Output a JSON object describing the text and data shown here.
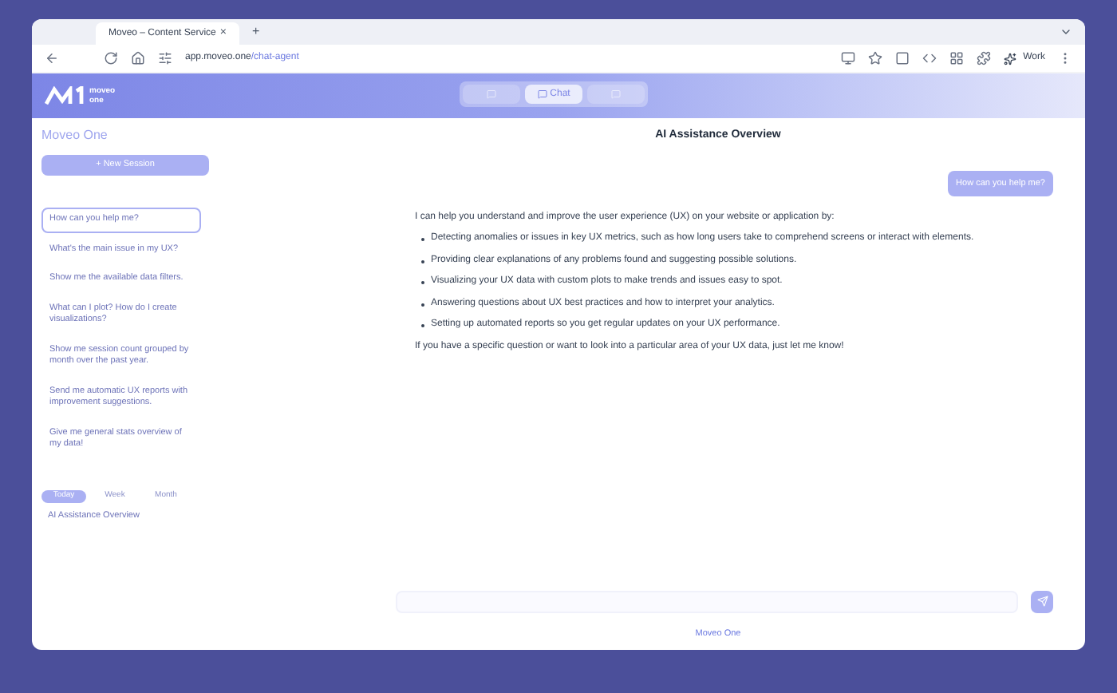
{
  "browser": {
    "tab_title": "Moveo – Content Service",
    "tab_close": "×",
    "new_tab": "+",
    "url_host": "app.moveo.one",
    "url_path": "/chat-agent",
    "profile": "Work"
  },
  "header": {
    "logo_text": "moveo one",
    "nav": [
      {
        "selected": false
      },
      {
        "label": "Chat",
        "selected": true
      },
      {
        "selected": false
      }
    ]
  },
  "sidebar": {
    "title": "Moveo One",
    "new_button": "+ New Session",
    "suggestions": [
      {
        "text": "How can you help me?",
        "selected": true
      },
      {
        "text": "What's the main issue in my UX?",
        "selected": false
      },
      {
        "text": "Show me the available data filters.",
        "selected": false
      },
      {
        "text": "What can I plot? How do I create visualizations?",
        "selected": false
      },
      {
        "text": "Show me session count grouped by month over the past year.",
        "selected": false
      },
      {
        "text": "Send me automatic UX reports with improvement suggestions.",
        "selected": false
      },
      {
        "text": "Give me general stats overview of my data!",
        "selected": false
      }
    ],
    "periods": [
      {
        "label": "Today",
        "selected": true
      },
      {
        "label": "Week",
        "selected": false
      },
      {
        "label": "Month",
        "selected": false
      }
    ],
    "history": [
      "AI Assistance Overview"
    ]
  },
  "chat": {
    "title": "AI Assistance Overview",
    "user_message": "How can you help me?",
    "reply_intro": "I can help you understand and improve the user experience (UX) on your website or application by:",
    "reply_points": [
      "Detecting anomalies or issues in key UX metrics, such as how long users take to comprehend screens or interact with elements.",
      "Providing clear explanations of any problems found and suggesting possible solutions.",
      "Visualizing your UX data with custom plots to make trends and issues easy to spot.",
      "Answering questions about UX best practices and how to interpret your analytics.",
      "Setting up automated reports so you get regular updates on your UX performance."
    ],
    "reply_outro": "If you have a specific question or want to look into a particular area of your UX data, just let me know!",
    "footer_link": "Moveo One"
  }
}
